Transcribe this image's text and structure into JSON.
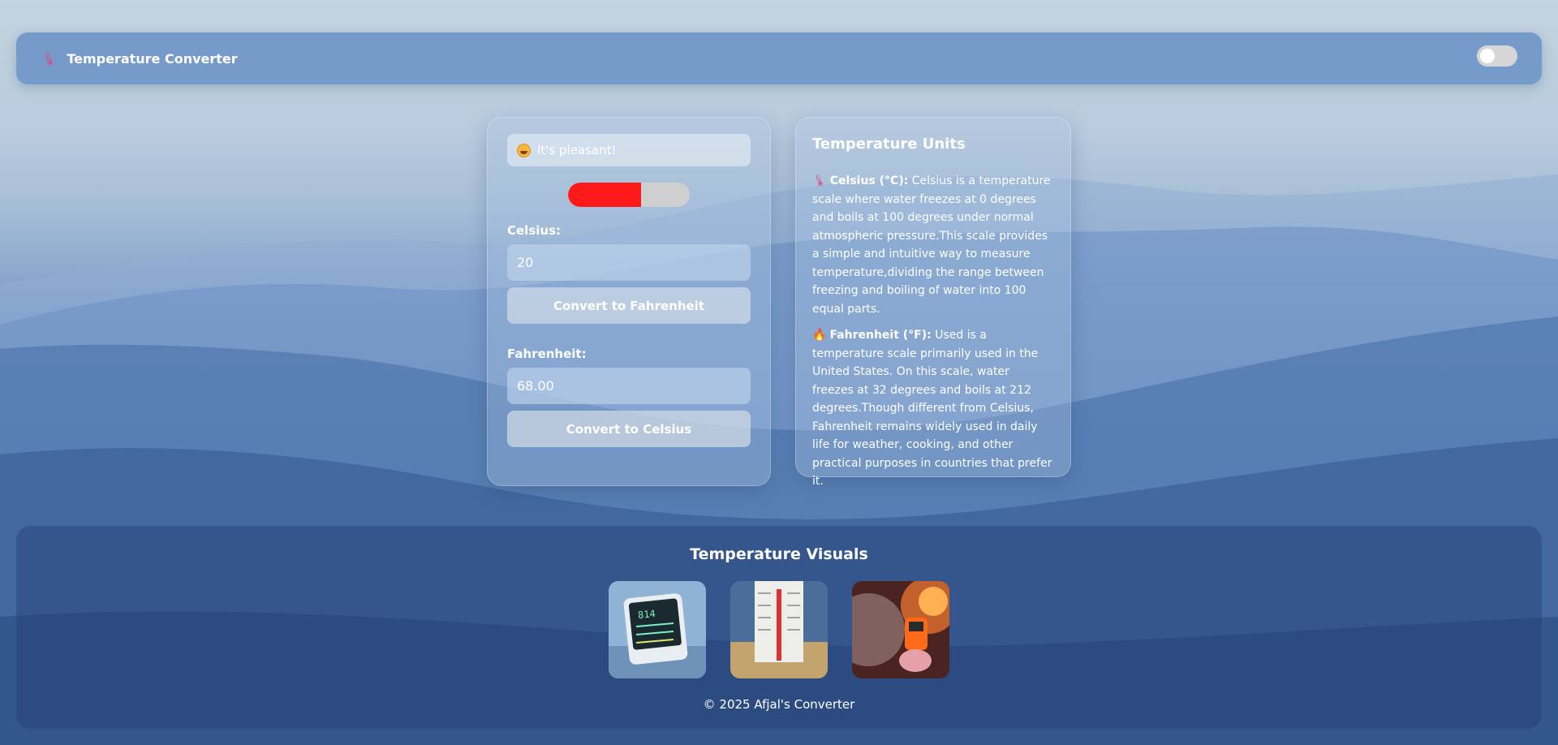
{
  "navbar": {
    "icon": "thermometer-icon",
    "title": "Temperature Converter",
    "toggle_state": "off"
  },
  "converter": {
    "mood_icon": "smiling-face-icon",
    "mood_text": "It's pleasant!",
    "gauge_level_percent": 60,
    "gauge_color": "#ff1a1a",
    "celsius_label": "Celsius:",
    "celsius_value": "20",
    "convert_to_f_label": "Convert to Fahrenheit",
    "fahrenheit_label": "Fahrenheit:",
    "fahrenheit_value": "68.00",
    "convert_to_c_label": "Convert to Celsius"
  },
  "info": {
    "title": "Temperature Units",
    "celsius_icon": "thermometer-icon",
    "celsius_term": "Celsius (°C):",
    "celsius_text": " Celsius is a temperature scale where water freezes at 0 degrees and boils at 100 degrees under normal atmospheric pressure.This scale provides a simple and intuitive way to measure temperature,dividing the range between freezing and boiling of water into 100 equal parts.",
    "fahrenheit_icon": "fire-icon",
    "fahrenheit_term": "Fahrenheit (°F):",
    "fahrenheit_text": " Used is a temperature scale primarily used in the United States. On this scale, water freezes at 32 degrees and boils at 212 degrees.Though different from Celsius, Fahrenheit remains widely used in daily life for weather, cooking, and other practical purposes in countries that prefer it."
  },
  "visuals": {
    "title": "Temperature Visuals",
    "images": [
      "digital-thermometer-display",
      "thermometer-in-sand",
      "infrared-thermometer-fire"
    ],
    "footer": "© 2025 Afjal's Converter"
  }
}
